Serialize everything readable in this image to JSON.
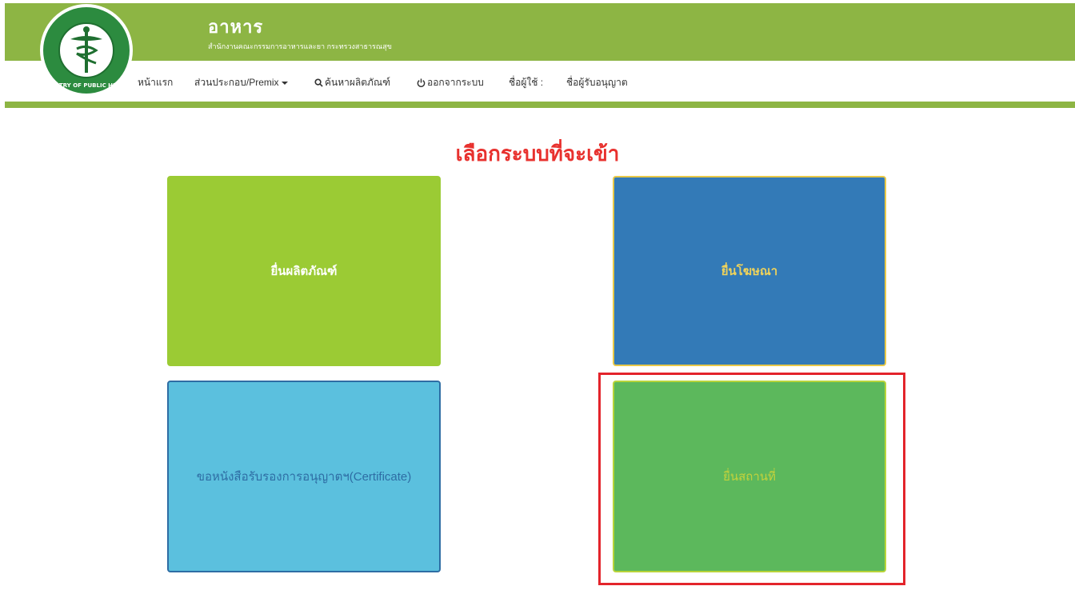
{
  "header": {
    "title": "อาหาร",
    "subtitle": "สำนักงานคณะกรรมการอาหารและยา กระทรวงสาธารณสุข",
    "logo_icon": "ministry-of-public-health-seal",
    "logo_text": "MINISTRY OF PUBLIC HEALTH",
    "bar_color": "#8db544"
  },
  "nav": {
    "home": "หน้าแรก",
    "premix": "ส่วนประกอบ/Premix",
    "search": "ค้นหาผลิตภัณฑ์",
    "logout": "ออกจากระบบ",
    "username_label": "ชื่อผู้ใช้ :",
    "licensee_label": "ชื่อผู้รับอนุญาต"
  },
  "main": {
    "heading": "เลือกระบบที่จะเข้า",
    "heading_color": "#e8312e",
    "cards": [
      {
        "label": "ยื่นผลิตภัณฑ์",
        "color": "#9bcb34"
      },
      {
        "label": "ยื่นโฆษณา",
        "color": "#337ab7"
      },
      {
        "label": "ขอหนังสือรับรองการอนุญาตฯ(Certificate)",
        "color": "#5bc0de"
      },
      {
        "label": "ยื่นสถานที่",
        "color": "#5cb85c"
      }
    ],
    "highlight_color": "#e3242b"
  }
}
